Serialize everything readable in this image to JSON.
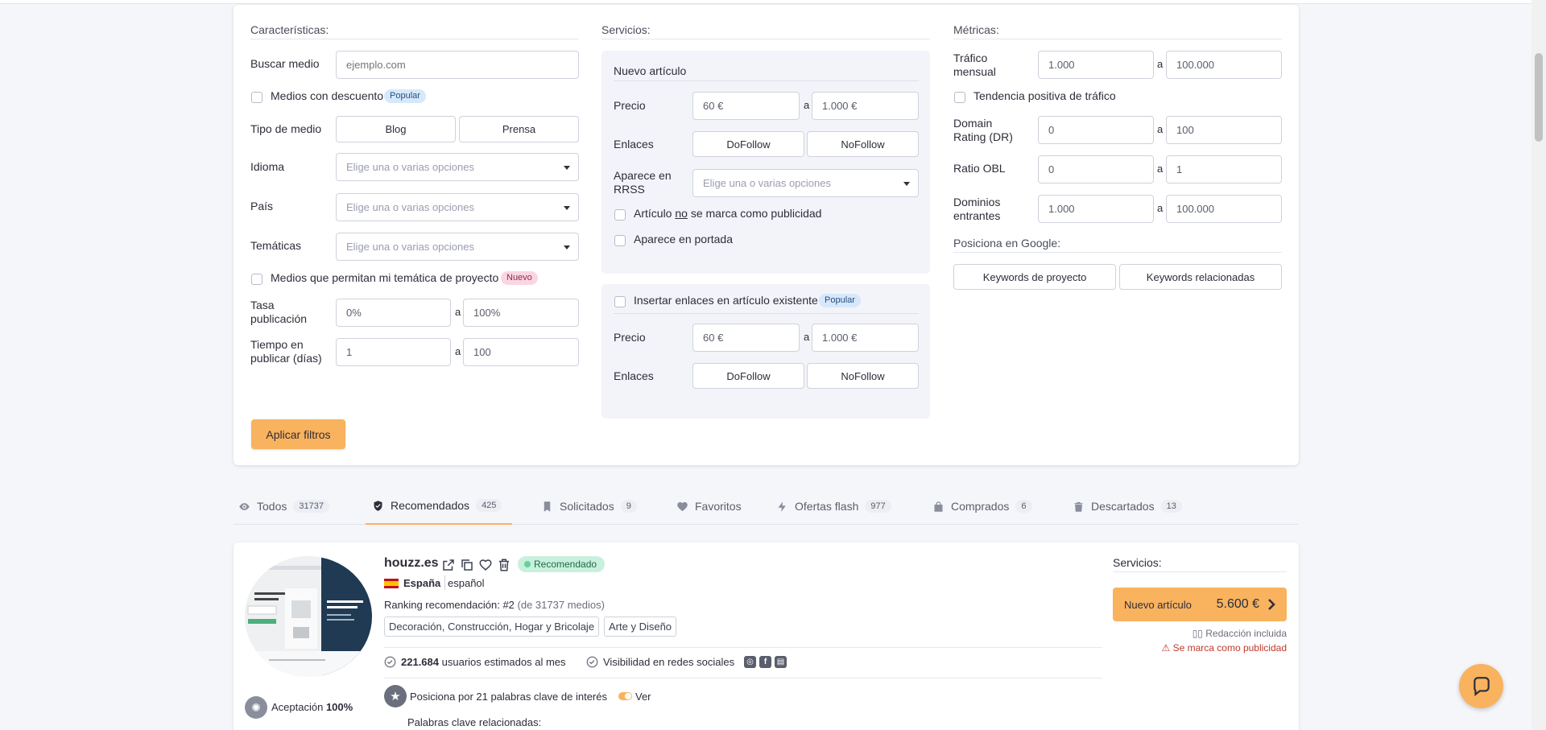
{
  "filters": {
    "caracteristicas": {
      "title": "Características:",
      "buscar_label": "Buscar medio",
      "buscar_placeholder": "ejemplo.com",
      "descuento_label": "Medios con descuento",
      "descuento_badge": "Popular",
      "tipo_label": "Tipo de medio",
      "tipo_options": [
        "Blog",
        "Prensa"
      ],
      "idioma_label": "Idioma",
      "pais_label": "País",
      "tematicas_label": "Temáticas",
      "select_placeholder": "Elige una o varias opciones",
      "tematica_proyecto_label": "Medios que permitan mi temática de proyecto",
      "tematica_proyecto_badge": "Nuevo",
      "tasa_label_1": "Tasa",
      "tasa_label_2": "publicación",
      "tasa_min": "0%",
      "tasa_max": "100%",
      "tiempo_label_1": "Tiempo en",
      "tiempo_label_2": "publicar (días)",
      "tiempo_min": "1",
      "tiempo_max": "100",
      "range_sep": "a"
    },
    "servicios": {
      "title": "Servicios:",
      "nuevo_title": "Nuevo artículo",
      "precio_label": "Precio",
      "precio_min": "60 €",
      "precio_max": "1.000 €",
      "enlaces_label": "Enlaces",
      "dofollow": "DoFollow",
      "nofollow": "NoFollow",
      "rrss_label_1": "Aparece en",
      "rrss_label_2": "RRSS",
      "no_publi_pre": "Artículo",
      "no_publi_no": "no",
      "no_publi_post": "se marca como publicidad",
      "portada_label": "Aparece en portada",
      "insertar_label": "Insertar enlaces en artículo existente",
      "insertar_badge": "Popular"
    },
    "metricas": {
      "title": "Métricas:",
      "trafico_label_1": "Tráfico",
      "trafico_label_2": "mensual",
      "trafico_min": "1.000",
      "trafico_max": "100.000",
      "tendencia_label": "Tendencia positiva de tráfico",
      "dr_label_1": "Domain",
      "dr_label_2": "Rating (DR)",
      "dr_min": "0",
      "dr_max": "100",
      "obl_label": "Ratio OBL",
      "obl_min": "0",
      "obl_max": "1",
      "dominios_label_1": "Dominios",
      "dominios_label_2": "entrantes",
      "dominios_min": "1.000",
      "dominios_max": "100.000",
      "google_title": "Posiciona en Google:",
      "kw_proyecto": "Keywords de proyecto",
      "kw_relacionadas": "Keywords relacionadas"
    },
    "apply_label": "Aplicar filtros"
  },
  "tabs": [
    {
      "label": "Todos",
      "count": "31737",
      "icon": "eye-icon"
    },
    {
      "label": "Recomendados",
      "count": "425",
      "icon": "shield-check-icon"
    },
    {
      "label": "Solicitados",
      "count": "9",
      "icon": "bookmark-icon"
    },
    {
      "label": "Favoritos",
      "count": "",
      "icon": "heart-icon"
    },
    {
      "label": "Ofertas flash",
      "count": "977",
      "icon": "bolt-icon"
    },
    {
      "label": "Comprados",
      "count": "6",
      "icon": "bag-icon"
    },
    {
      "label": "Descartados",
      "count": "13",
      "icon": "trash-icon"
    }
  ],
  "result": {
    "site": "houzz.es",
    "recommended_badge": "Recomendado",
    "country": "España",
    "language": "español",
    "ranking_prefix": "Ranking recomendación:",
    "ranking_value": "#2",
    "ranking_suffix": "(de 31737 medios)",
    "tags": [
      "Decoración, Construcción, Hogar y Bricolaje",
      "Arte y Diseño"
    ],
    "users_value": "221.684",
    "users_suffix": "usuarios estimados al mes",
    "social_label": "Visibilidad en redes sociales",
    "keywords_text": "Posiciona por 21 palabras clave de interés",
    "keywords_link": "Ver",
    "related_label": "Palabras clave relacionadas:",
    "acceptance_label": "Aceptación",
    "acceptance_value": "100%",
    "services_title": "Servicios:",
    "buy_label": "Nuevo artículo",
    "buy_price": "5.600 €",
    "note_redaccion": "Redacción incluida",
    "note_publicidad": "Se marca como publicidad"
  },
  "colors": {
    "accent": "#f9b25e",
    "recommended_bg": "#c9f0dd",
    "warning_text": "#c0392b"
  }
}
